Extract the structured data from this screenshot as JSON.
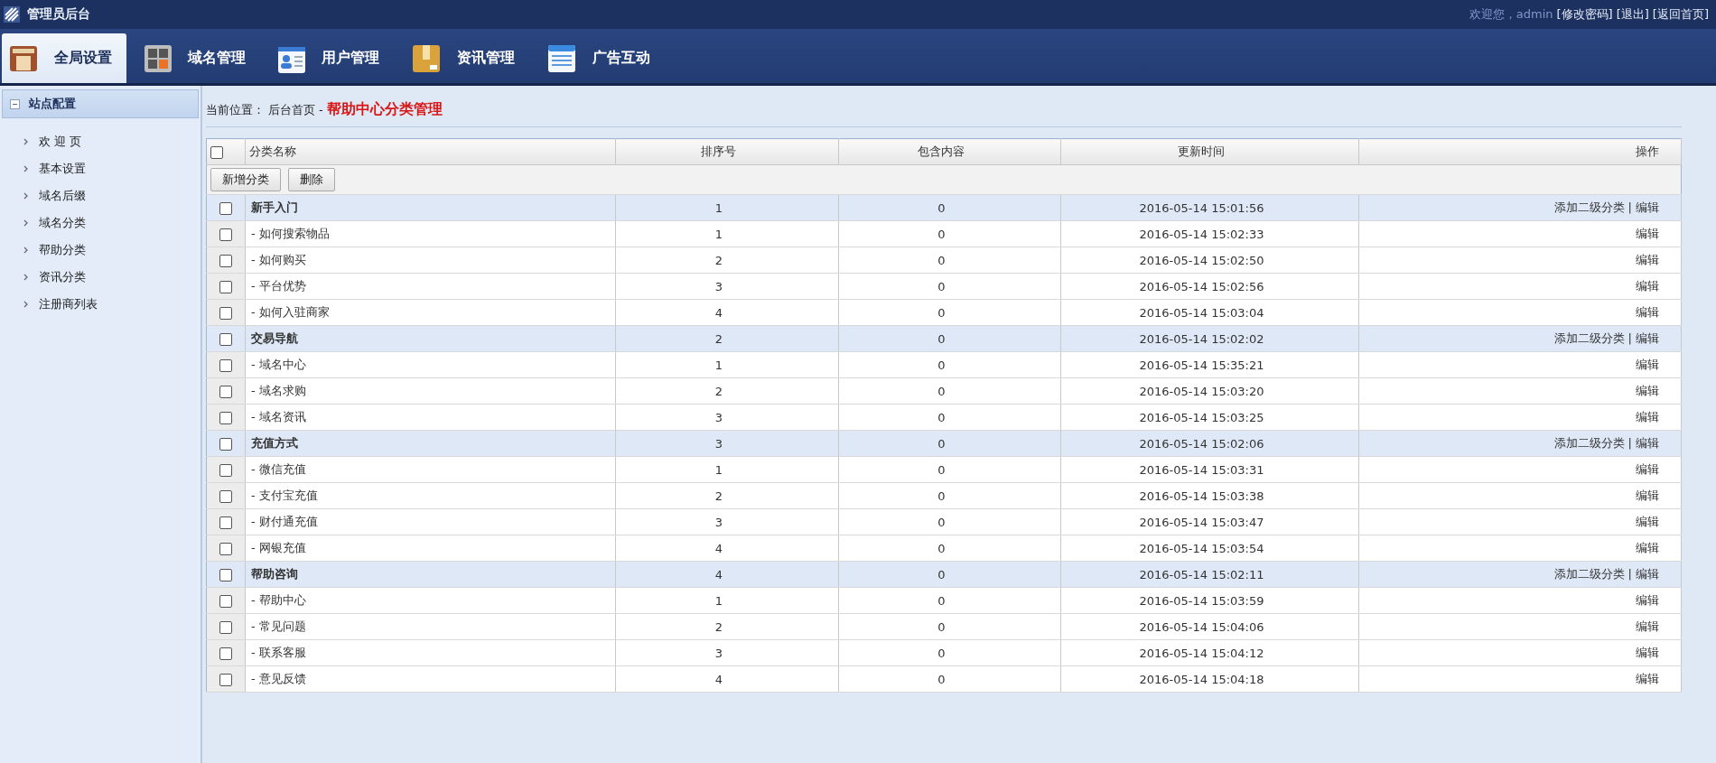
{
  "header": {
    "title": "管理员后台",
    "welcome": "欢迎您，admin",
    "links": [
      "[修改密码]",
      "[退出]",
      "[返回首页]"
    ]
  },
  "nav_tabs": [
    {
      "label": "全局设置",
      "selected": true
    },
    {
      "label": "域名管理",
      "selected": false
    },
    {
      "label": "用户管理",
      "selected": false
    },
    {
      "label": "资讯管理",
      "selected": false
    },
    {
      "label": "广告互动",
      "selected": false
    }
  ],
  "sidebar": {
    "section": {
      "title": "站点配置",
      "expanded": true
    },
    "items": [
      "欢 迎 页",
      "基本设置",
      "域名后缀",
      "域名分类",
      "帮助分类",
      "资讯分类",
      "注册商列表"
    ]
  },
  "breadcrumb": {
    "label": "当前位置：",
    "home": "后台首页",
    "separator": "-",
    "current": "帮助中心分类管理"
  },
  "table": {
    "columns": [
      "分类名称",
      "排序号",
      "包含内容",
      "更新时间",
      "操作"
    ],
    "header_checked": false,
    "buttons": [
      "新增分类",
      "删除"
    ],
    "action_separator": "|",
    "groups": [
      {
        "name": "新手入门",
        "sort": "1",
        "count": "0",
        "time": "2016-05-14 15:01:56",
        "checked": false,
        "actions": [
          "添加二级分类",
          "编辑"
        ],
        "children": [
          {
            "name": "- 如何搜索物品",
            "sort": "1",
            "count": "0",
            "time": "2016-05-14 15:02:33",
            "checked": false,
            "actions": [
              "编辑"
            ]
          },
          {
            "name": "- 如何购买",
            "sort": "2",
            "count": "0",
            "time": "2016-05-14 15:02:50",
            "checked": false,
            "actions": [
              "编辑"
            ]
          },
          {
            "name": "- 平台优势",
            "sort": "3",
            "count": "0",
            "time": "2016-05-14 15:02:56",
            "checked": false,
            "actions": [
              "编辑"
            ]
          },
          {
            "name": "- 如何入驻商家",
            "sort": "4",
            "count": "0",
            "time": "2016-05-14 15:03:04",
            "checked": false,
            "actions": [
              "编辑"
            ]
          }
        ]
      },
      {
        "name": "交易导航",
        "sort": "2",
        "count": "0",
        "time": "2016-05-14 15:02:02",
        "checked": false,
        "actions": [
          "添加二级分类",
          "编辑"
        ],
        "children": [
          {
            "name": "- 域名中心",
            "sort": "1",
            "count": "0",
            "time": "2016-05-14 15:35:21",
            "checked": false,
            "actions": [
              "编辑"
            ]
          },
          {
            "name": "- 域名求购",
            "sort": "2",
            "count": "0",
            "time": "2016-05-14 15:03:20",
            "checked": false,
            "actions": [
              "编辑"
            ]
          },
          {
            "name": "- 域名资讯",
            "sort": "3",
            "count": "0",
            "time": "2016-05-14 15:03:25",
            "checked": false,
            "actions": [
              "编辑"
            ]
          }
        ]
      },
      {
        "name": "充值方式",
        "sort": "3",
        "count": "0",
        "time": "2016-05-14 15:02:06",
        "checked": false,
        "actions": [
          "添加二级分类",
          "编辑"
        ],
        "children": [
          {
            "name": "- 微信充值",
            "sort": "1",
            "count": "0",
            "time": "2016-05-14 15:03:31",
            "checked": false,
            "actions": [
              "编辑"
            ]
          },
          {
            "name": "- 支付宝充值",
            "sort": "2",
            "count": "0",
            "time": "2016-05-14 15:03:38",
            "checked": false,
            "actions": [
              "编辑"
            ]
          },
          {
            "name": "- 财付通充值",
            "sort": "3",
            "count": "0",
            "time": "2016-05-14 15:03:47",
            "checked": false,
            "actions": [
              "编辑"
            ]
          },
          {
            "name": "- 网银充值",
            "sort": "4",
            "count": "0",
            "time": "2016-05-14 15:03:54",
            "checked": false,
            "actions": [
              "编辑"
            ]
          }
        ]
      },
      {
        "name": "帮助咨询",
        "sort": "4",
        "count": "0",
        "time": "2016-05-14 15:02:11",
        "checked": false,
        "actions": [
          "添加二级分类",
          "编辑"
        ],
        "children": [
          {
            "name": "- 帮助中心",
            "sort": "1",
            "count": "0",
            "time": "2016-05-14 15:03:59",
            "checked": false,
            "actions": [
              "编辑"
            ]
          },
          {
            "name": "- 常见问题",
            "sort": "2",
            "count": "0",
            "time": "2016-05-14 15:04:06",
            "checked": false,
            "actions": [
              "编辑"
            ]
          },
          {
            "name": "- 联系客服",
            "sort": "3",
            "count": "0",
            "time": "2016-05-14 15:04:12",
            "checked": false,
            "actions": [
              "编辑"
            ]
          },
          {
            "name": "- 意见反馈",
            "sort": "4",
            "count": "0",
            "time": "2016-05-14 15:04:18",
            "checked": false,
            "actions": [
              "编辑"
            ]
          }
        ]
      }
    ]
  }
}
